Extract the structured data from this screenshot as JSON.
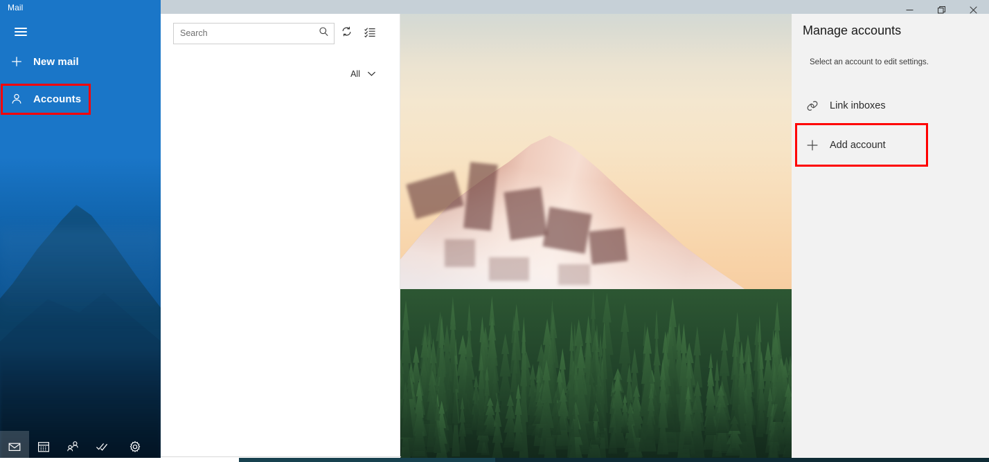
{
  "window": {
    "app_title": "Mail",
    "controls": {
      "minimize_label": "Minimize",
      "restore_label": "Restore",
      "close_label": "Close"
    },
    "titlebar_color": "#c6d0d7"
  },
  "sidebar": {
    "accent_color": "#1572c5",
    "menu_label": "Menu",
    "items": [
      {
        "id": "new-mail",
        "label": "New mail",
        "icon": "plus-icon"
      },
      {
        "id": "accounts",
        "label": "Accounts",
        "icon": "person-icon",
        "highlighted": true
      }
    ],
    "rail": [
      {
        "id": "mail",
        "icon": "mail-icon",
        "label": "Mail",
        "active": true
      },
      {
        "id": "calendar",
        "icon": "calendar-icon",
        "label": "Calendar",
        "active": false
      },
      {
        "id": "people",
        "icon": "people-icon",
        "label": "People",
        "active": false
      },
      {
        "id": "todo",
        "icon": "checkmark-icon",
        "label": "To Do",
        "active": false
      },
      {
        "id": "settings",
        "icon": "gear-icon",
        "label": "Settings",
        "active": false
      }
    ]
  },
  "list_pane": {
    "search": {
      "placeholder": "Search",
      "value": "",
      "icon": "search-icon"
    },
    "toolbar": [
      {
        "id": "sync",
        "icon": "sync-icon",
        "label": "Sync this view"
      },
      {
        "id": "selection-mode",
        "icon": "selection-mode-icon",
        "label": "Enter selection mode"
      }
    ],
    "filter": {
      "label": "All",
      "icon": "chevron-down-icon"
    },
    "messages": []
  },
  "settings_pane": {
    "title": "Manage accounts",
    "subtitle": "Select an account to edit settings.",
    "background_color": "#f2f2f2",
    "items": [
      {
        "id": "link-inboxes",
        "label": "Link inboxes",
        "icon": "link-icon",
        "highlighted": false
      },
      {
        "id": "add-account",
        "label": "Add account",
        "icon": "plus-icon",
        "highlighted": true
      }
    ]
  },
  "highlights": {
    "color": "#ff0000",
    "targets": [
      "accounts",
      "add-account"
    ]
  }
}
